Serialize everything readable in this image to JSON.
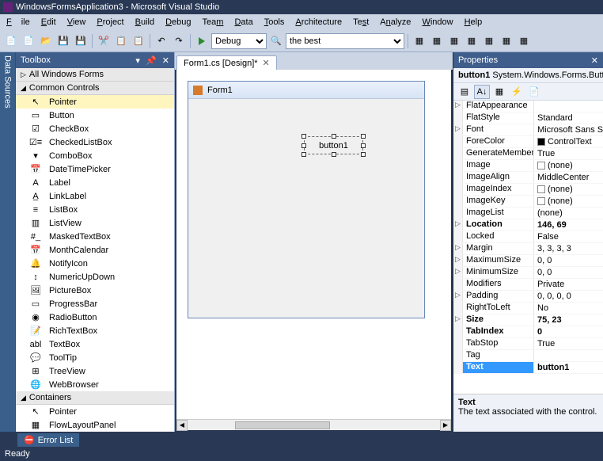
{
  "title": {
    "app": "WindowsFormsApplication3",
    "suffix": "Microsoft Visual Studio"
  },
  "menu": {
    "file": "File",
    "edit": "Edit",
    "view": "View",
    "project": "Project",
    "build": "Build",
    "debug": "Debug",
    "team": "Team",
    "data": "Data",
    "tools": "Tools",
    "architecture": "Architecture",
    "test": "Test",
    "analyze": "Analyze",
    "window": "Window",
    "help": "Help"
  },
  "toolbar": {
    "config": "Debug",
    "platform": "the best"
  },
  "dataSourcesTab": "Data Sources",
  "toolbox": {
    "title": "Toolbox",
    "groups": {
      "all": "All Windows Forms",
      "controls": "Common Controls",
      "containers": "Containers"
    },
    "items": [
      {
        "icon": "pointer",
        "label": "Pointer",
        "selected": true
      },
      {
        "icon": "button",
        "label": "Button"
      },
      {
        "icon": "checkbox",
        "label": "CheckBox"
      },
      {
        "icon": "checkedlist",
        "label": "CheckedListBox"
      },
      {
        "icon": "combo",
        "label": "ComboBox"
      },
      {
        "icon": "datetime",
        "label": "DateTimePicker"
      },
      {
        "icon": "label",
        "label": "Label"
      },
      {
        "icon": "link",
        "label": "LinkLabel"
      },
      {
        "icon": "listbox",
        "label": "ListBox"
      },
      {
        "icon": "listview",
        "label": "ListView"
      },
      {
        "icon": "masked",
        "label": "MaskedTextBox"
      },
      {
        "icon": "month",
        "label": "MonthCalendar"
      },
      {
        "icon": "notify",
        "label": "NotifyIcon"
      },
      {
        "icon": "numeric",
        "label": "NumericUpDown"
      },
      {
        "icon": "picture",
        "label": "PictureBox"
      },
      {
        "icon": "progress",
        "label": "ProgressBar"
      },
      {
        "icon": "radio",
        "label": "RadioButton"
      },
      {
        "icon": "rich",
        "label": "RichTextBox"
      },
      {
        "icon": "textbox",
        "label": "TextBox"
      },
      {
        "icon": "tooltip",
        "label": "ToolTip"
      },
      {
        "icon": "tree",
        "label": "TreeView"
      },
      {
        "icon": "web",
        "label": "WebBrowser"
      }
    ],
    "containerItems": [
      {
        "icon": "pointer",
        "label": "Pointer"
      },
      {
        "icon": "flow",
        "label": "FlowLayoutPanel"
      }
    ]
  },
  "designer": {
    "tab": "Form1.cs [Design]*",
    "formTitle": "Form1",
    "buttonText": "button1"
  },
  "properties": {
    "title": "Properties",
    "objectName": "button1",
    "objectType": "System.Windows.Forms.Button",
    "rows": [
      {
        "exp": "▷",
        "name": "FlatAppearance",
        "value": ""
      },
      {
        "name": "FlatStyle",
        "value": "Standard"
      },
      {
        "exp": "▷",
        "name": "Font",
        "value": "Microsoft Sans Ser"
      },
      {
        "name": "ForeColor",
        "value": "ControlText",
        "swatch": "#000"
      },
      {
        "name": "GenerateMember",
        "value": "True"
      },
      {
        "name": "Image",
        "value": "(none)",
        "swatch": "#fff"
      },
      {
        "name": "ImageAlign",
        "value": "MiddleCenter"
      },
      {
        "name": "ImageIndex",
        "value": "(none)",
        "swatch": "#fff"
      },
      {
        "name": "ImageKey",
        "value": "(none)",
        "swatch": "#fff"
      },
      {
        "name": "ImageList",
        "value": "(none)"
      },
      {
        "exp": "▷",
        "name": "Location",
        "value": "146, 69",
        "bold": true
      },
      {
        "name": "Locked",
        "value": "False"
      },
      {
        "exp": "▷",
        "name": "Margin",
        "value": "3, 3, 3, 3"
      },
      {
        "exp": "▷",
        "name": "MaximumSize",
        "value": "0, 0"
      },
      {
        "exp": "▷",
        "name": "MinimumSize",
        "value": "0, 0"
      },
      {
        "name": "Modifiers",
        "value": "Private"
      },
      {
        "exp": "▷",
        "name": "Padding",
        "value": "0, 0, 0, 0"
      },
      {
        "name": "RightToLeft",
        "value": "No"
      },
      {
        "exp": "▷",
        "name": "Size",
        "value": "75, 23",
        "bold": true
      },
      {
        "name": "TabIndex",
        "value": "0",
        "bold": true
      },
      {
        "name": "TabStop",
        "value": "True"
      },
      {
        "name": "Tag",
        "value": ""
      },
      {
        "name": "Text",
        "value": "button1",
        "bold": true,
        "selected": true
      }
    ],
    "descTitle": "Text",
    "descBody": "The text associated with the control."
  },
  "errorList": "Error List",
  "status": "Ready"
}
